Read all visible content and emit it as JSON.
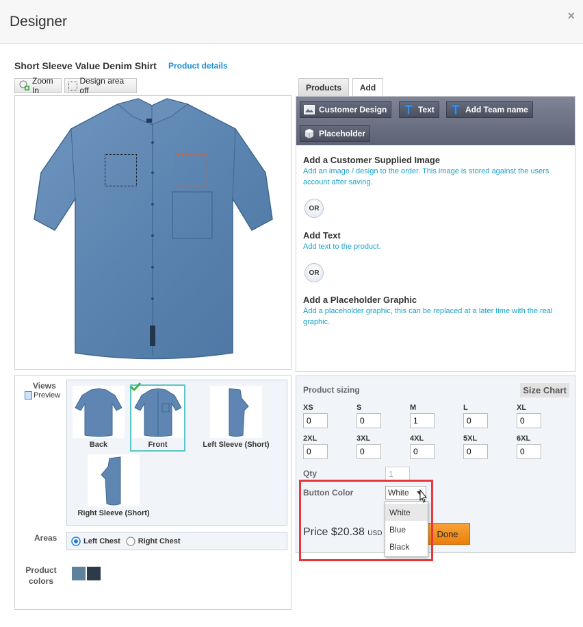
{
  "dialog": {
    "title": "Designer",
    "close_glyph": "×"
  },
  "product": {
    "name": "Short Sleeve Value Denim Shirt",
    "details_link": "Product details"
  },
  "toolbar": {
    "zoom_in": "Zoom In",
    "design_area": "Design area off"
  },
  "tabs": [
    {
      "label": "Products",
      "active": false
    },
    {
      "label": "Add",
      "active": true
    }
  ],
  "design_buttons": {
    "customer_design": "Customer Design",
    "text": "Text",
    "team_name": "Add Team name",
    "placeholder": "Placeholder"
  },
  "add_sections": {
    "image": {
      "title": "Add a Customer Supplied Image",
      "desc": "Add an image / design to the order. This image is stored against the users account after saving."
    },
    "or1": "OR",
    "text": {
      "title": "Add Text",
      "desc": "Add text to the product."
    },
    "or2": "OR",
    "placeholder": {
      "title": "Add a Placeholder Graphic",
      "desc": "Add a placeholder graphic, this can be replaced at a later time with the real graphic."
    }
  },
  "views": {
    "label": "Views",
    "preview": "Preview",
    "items": [
      {
        "label": "Back"
      },
      {
        "label": "Front",
        "selected": true
      },
      {
        "label": "Left Sleeve (Short)"
      },
      {
        "label": "Right Sleeve (Short)"
      }
    ]
  },
  "areas": {
    "label": "Areas",
    "options": [
      {
        "label": "Left Chest",
        "checked": true
      },
      {
        "label": "Right Chest",
        "checked": false
      }
    ]
  },
  "product_colors": {
    "label_line1": "Product",
    "label_line2": "colors",
    "swatches": [
      "#5f829c",
      "#2c3a4a"
    ]
  },
  "sizing": {
    "title": "Product sizing",
    "size_chart": "Size Chart",
    "row1": [
      {
        "size": "XS",
        "value": "0"
      },
      {
        "size": "S",
        "value": "0"
      },
      {
        "size": "M",
        "value": "1"
      },
      {
        "size": "L",
        "value": "0"
      },
      {
        "size": "XL",
        "value": "0"
      }
    ],
    "row2": [
      {
        "size": "2XL",
        "value": "0"
      },
      {
        "size": "3XL",
        "value": "0"
      },
      {
        "size": "4XL",
        "value": "0"
      },
      {
        "size": "5XL",
        "value": "0"
      },
      {
        "size": "6XL",
        "value": "0"
      }
    ],
    "qty_label": "Qty",
    "qty_value": "1"
  },
  "button_color": {
    "label": "Button Color",
    "selected": "White",
    "options": [
      "White",
      "Blue",
      "Black"
    ]
  },
  "price": {
    "label": "Price",
    "amount": "$20.38",
    "currency": "USD"
  },
  "done_button": "Done",
  "colors": {
    "link": "#1a8fd6",
    "desc_text": "#1aa0c8",
    "highlight_box": "#e8383d",
    "done_bg": "#f0890f",
    "selected_thumb": "#5cc6c6"
  }
}
